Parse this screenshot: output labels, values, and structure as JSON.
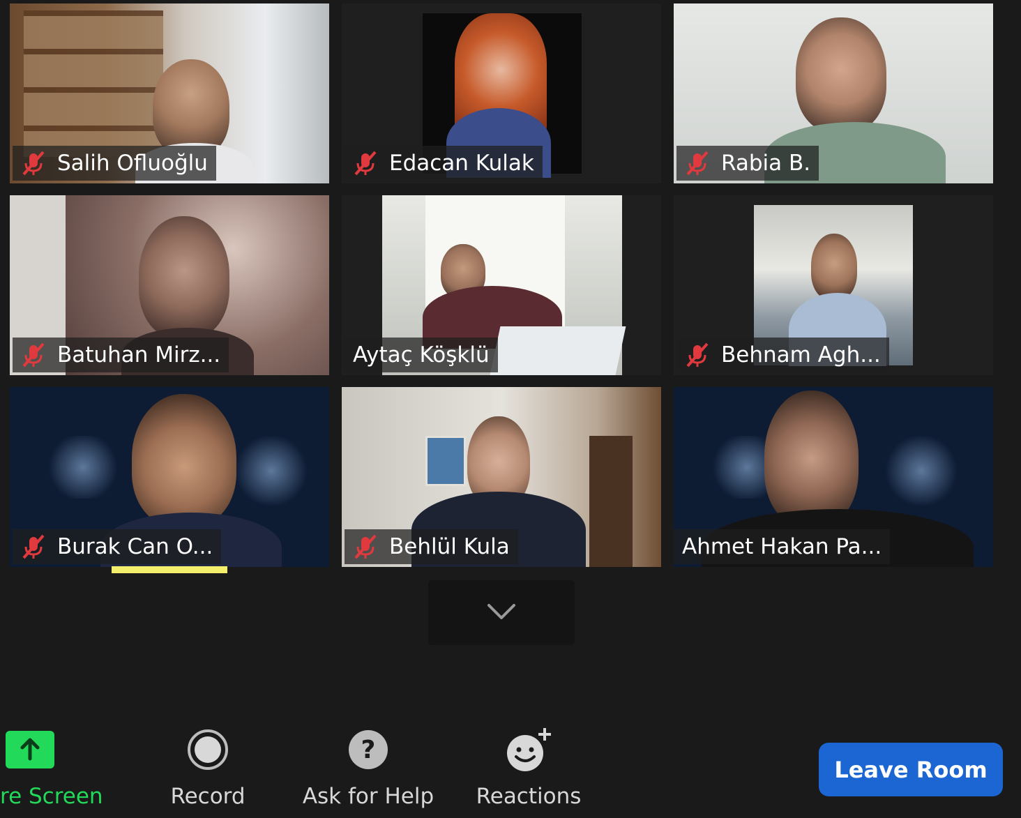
{
  "participants": [
    {
      "name": "Salih Ofluoğlu"
    },
    {
      "name": "Edacan Kulak"
    },
    {
      "name": "Rabia B."
    },
    {
      "name": "Batuhan Mirz..."
    },
    {
      "name": "Aytaç Köşklü"
    },
    {
      "name": "Behnam Agh..."
    },
    {
      "name": "Burak Can O..."
    },
    {
      "name": "Behlül Kula"
    },
    {
      "name": "Ahmet Hakan Pa..."
    }
  ],
  "toolbar": {
    "share_label": "re Screen",
    "record_label": "Record",
    "help_label": "Ask for Help",
    "reactions_label": "Reactions",
    "leave_label": "Leave Room"
  },
  "colors": {
    "background": "#1a1a1a",
    "mute_red": "#e0393e",
    "share_green": "#23d959",
    "speaking_yellow": "#f3ee6b",
    "leave_blue": "#1b66d2"
  },
  "icons": {
    "mute": "muted-microphone-icon",
    "more": "chevron-down-icon",
    "share": "upload-arrow-icon",
    "record": "record-circle-icon",
    "help": "question-mark-icon",
    "reactions": "smiley-plus-icon"
  }
}
